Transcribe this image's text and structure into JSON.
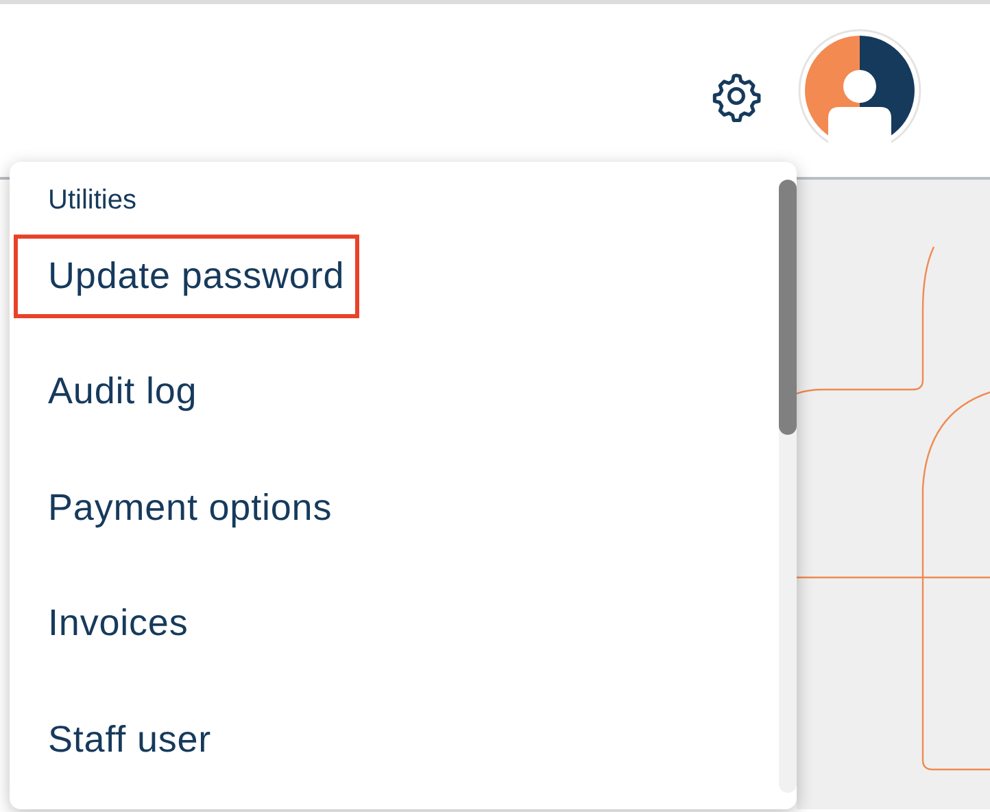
{
  "menu": {
    "section_label": "Utilities",
    "items": [
      {
        "label": "Update password",
        "selected": true
      },
      {
        "label": "Audit log",
        "selected": false
      },
      {
        "label": "Payment options",
        "selected": false
      },
      {
        "label": "Invoices",
        "selected": false
      },
      {
        "label": "Staff user",
        "selected": false
      }
    ]
  }
}
